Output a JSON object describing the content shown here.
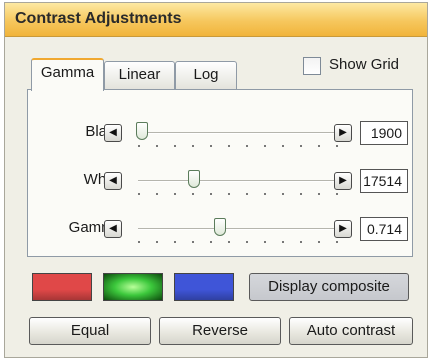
{
  "panel": {
    "title": "Contrast Adjustments"
  },
  "tabs": [
    {
      "label": "Gamma",
      "active": true
    },
    {
      "label": "Linear",
      "active": false
    },
    {
      "label": "Log",
      "active": false
    }
  ],
  "show_grid": {
    "label": "Show Grid",
    "checked": false
  },
  "sliders": {
    "black": {
      "label": "Black",
      "value": "1900",
      "level": 0.02
    },
    "white": {
      "label": "White",
      "value": "17514",
      "level": 0.28
    },
    "gamma": {
      "label": "Gamma",
      "value": "0.714",
      "level": 0.41
    }
  },
  "icons": {
    "decrease": "arrow-left-icon",
    "increase": "arrow-right-icon"
  },
  "channels": {
    "red": {
      "name": "red-channel-swatch",
      "color": "#e04848"
    },
    "green": {
      "name": "green-channel-swatch",
      "color": "#3cc83c",
      "selected": true
    },
    "blue": {
      "name": "blue-channel-swatch",
      "color": "#3f55d8"
    }
  },
  "buttons": {
    "display_composite": "Display composite",
    "equal": "Equal",
    "reverse": "Reverse",
    "auto_contrast": "Auto contrast"
  },
  "colors": {
    "title_bar": "#f6c75d",
    "panel_bg": "#f0efe6",
    "active_tab_accent": "#f0a830"
  }
}
